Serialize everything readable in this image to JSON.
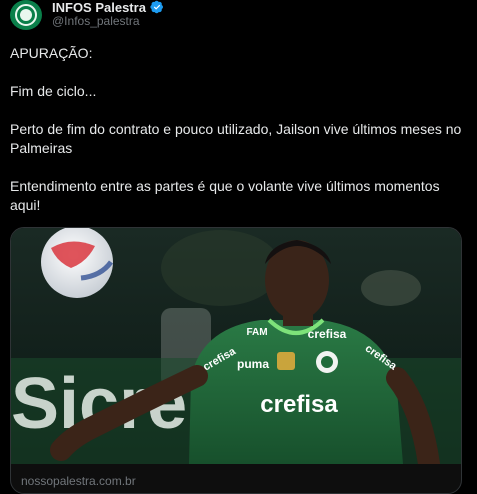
{
  "tweet": {
    "author": {
      "display_name": "INFOS Palestra",
      "handle": "@Infos_palestra",
      "verified": true,
      "avatar_icon": "palmeiras-crest-icon"
    },
    "paragraphs": [
      "APURAÇÃO:",
      "Fim de ciclo...",
      "Perto de fim do contrato e pouco utilizado, Jailson vive últimos meses no Palmeiras",
      "Entendimento entre as partes é que o volante vive últimos momentos aqui!"
    ],
    "card": {
      "jersey_sponsor": "crefisa",
      "jersey_brand": "puma",
      "jersey_maker": "FAM",
      "board_text": "Sicre",
      "domain": "nossopalestra.com.br"
    }
  },
  "colors": {
    "background": "#000000",
    "text": "#e7e9ea",
    "muted": "#71767b",
    "verified": "#1d9bf0",
    "border": "#2f3336",
    "jersey_green": "#1f6b3a"
  }
}
